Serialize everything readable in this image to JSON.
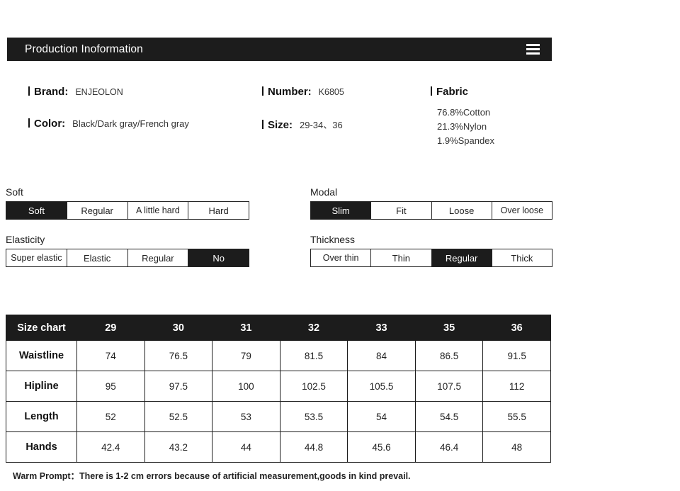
{
  "header": {
    "title": "Production Inoformation",
    "menu_icon": "hamburger-icon"
  },
  "info": {
    "brand": {
      "label": "| Brand:",
      "key": "Brand:",
      "value": "ENJEOLON"
    },
    "color": {
      "label": "| Color:",
      "key": "Color:",
      "value": "Black/Dark gray/French gray"
    },
    "number": {
      "label": "| Number:",
      "key": "Number:",
      "value": "K6805"
    },
    "size": {
      "label": "| Size:",
      "key": "Size:",
      "value": "29-34、36"
    },
    "fabric": {
      "key": "Fabric",
      "lines": [
        "76.8%Cotton",
        "21.3%Nylon",
        "1.9%Spandex"
      ]
    }
  },
  "options": [
    {
      "name": "soft",
      "label": "Soft",
      "selected": "Soft",
      "cells": [
        "Soft",
        "Regular",
        "A little hard",
        "Hard"
      ]
    },
    {
      "name": "elasticity",
      "label": "Elasticity",
      "selected": "No",
      "cells": [
        "Super elastic",
        "Elastic",
        "Regular",
        "No"
      ]
    },
    {
      "name": "modal",
      "label": "Modal",
      "selected": "Slim",
      "cells": [
        "Slim",
        "Fit",
        "Loose",
        "Over loose"
      ]
    },
    {
      "name": "thickness",
      "label": "Thickness",
      "selected": "Regular",
      "cells": [
        "Over thin",
        "Thin",
        "Regular",
        "Thick"
      ]
    }
  ],
  "size_chart": {
    "corner_label": "Size chart",
    "columns": [
      "29",
      "30",
      "31",
      "32",
      "33",
      "35",
      "36"
    ],
    "rows": [
      {
        "label": "Waistline",
        "values": [
          "74",
          "76.5",
          "79",
          "81.5",
          "84",
          "86.5",
          "91.5"
        ]
      },
      {
        "label": "Hipline",
        "values": [
          "95",
          "97.5",
          "100",
          "102.5",
          "105.5",
          "107.5",
          "112"
        ]
      },
      {
        "label": "Length",
        "values": [
          "52",
          "52.5",
          "53",
          "53.5",
          "54",
          "54.5",
          "55.5"
        ]
      },
      {
        "label": "Hands",
        "values": [
          "42.4",
          "43.2",
          "44",
          "44.8",
          "45.6",
          "46.4",
          "48"
        ]
      }
    ]
  },
  "footer": {
    "warm_prompt": "Warm Prompt：There is 1-2 cm errors because of artificial measurement,goods in kind prevail."
  },
  "colors": {
    "dark": "#1c1c1c",
    "text": "#222222",
    "background": "#ffffff"
  }
}
